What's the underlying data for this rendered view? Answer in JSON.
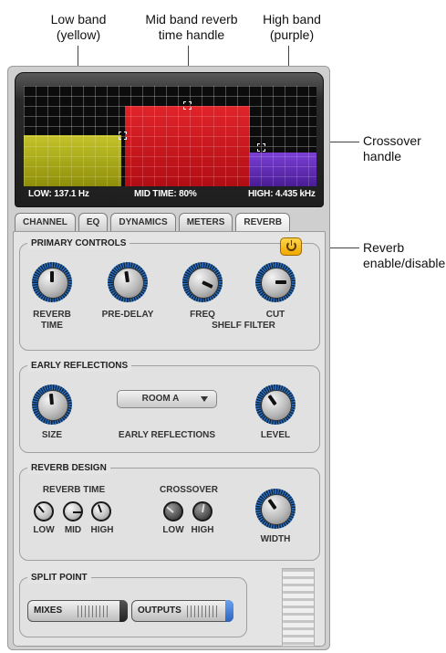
{
  "callouts": {
    "low_band": {
      "line1": "Low band",
      "line2": "(yellow)"
    },
    "mid_handle": {
      "line1": "Mid band reverb",
      "line2": "time handle"
    },
    "high_band": {
      "line1": "High band",
      "line2": "(purple)"
    },
    "crossover": {
      "line1": "Crossover",
      "line2": "handle"
    },
    "reverb_enable": {
      "line1": "Reverb",
      "line2": "enable/disable"
    }
  },
  "graph": {
    "readouts": {
      "low": "LOW: 137.1 Hz",
      "mid": "MID TIME: 80%",
      "high": "HIGH: 4.435 kHz"
    },
    "colors": {
      "low": "#b5b420",
      "mid": "#d41820",
      "high": "#5e2bb5"
    }
  },
  "tabs": [
    {
      "label": "CHANNEL",
      "active": false
    },
    {
      "label": "EQ",
      "active": false
    },
    {
      "label": "DYNAMICS",
      "active": false
    },
    {
      "label": "METERS",
      "active": false
    },
    {
      "label": "REVERB",
      "active": true
    }
  ],
  "primary": {
    "title": "PRIMARY CONTROLS",
    "power_icon": "power-icon",
    "power_color": "#f4b400",
    "knobs": {
      "reverb_time_1": "REVERB",
      "reverb_time_2": "TIME",
      "pre_delay": "PRE-DELAY",
      "freq": "FREQ",
      "cut": "CUT"
    },
    "shelf_filter": "SHELF FILTER"
  },
  "early": {
    "title": "EARLY REFLECTIONS",
    "size": "SIZE",
    "room_value": "ROOM A",
    "early_label": "EARLY REFLECTIONS",
    "level": "LEVEL"
  },
  "design": {
    "title": "REVERB DESIGN",
    "reverb_time": "REVERB TIME",
    "crossover": "CROSSOVER",
    "low": "LOW",
    "mid": "MID",
    "high": "HIGH",
    "xlow": "LOW",
    "xhigh": "HIGH",
    "width": "WIDTH"
  },
  "split": {
    "title": "SPLIT POINT",
    "mixes": "MIXES",
    "outputs": "OUTPUTS",
    "outputs_color": "#3a7ad8"
  }
}
